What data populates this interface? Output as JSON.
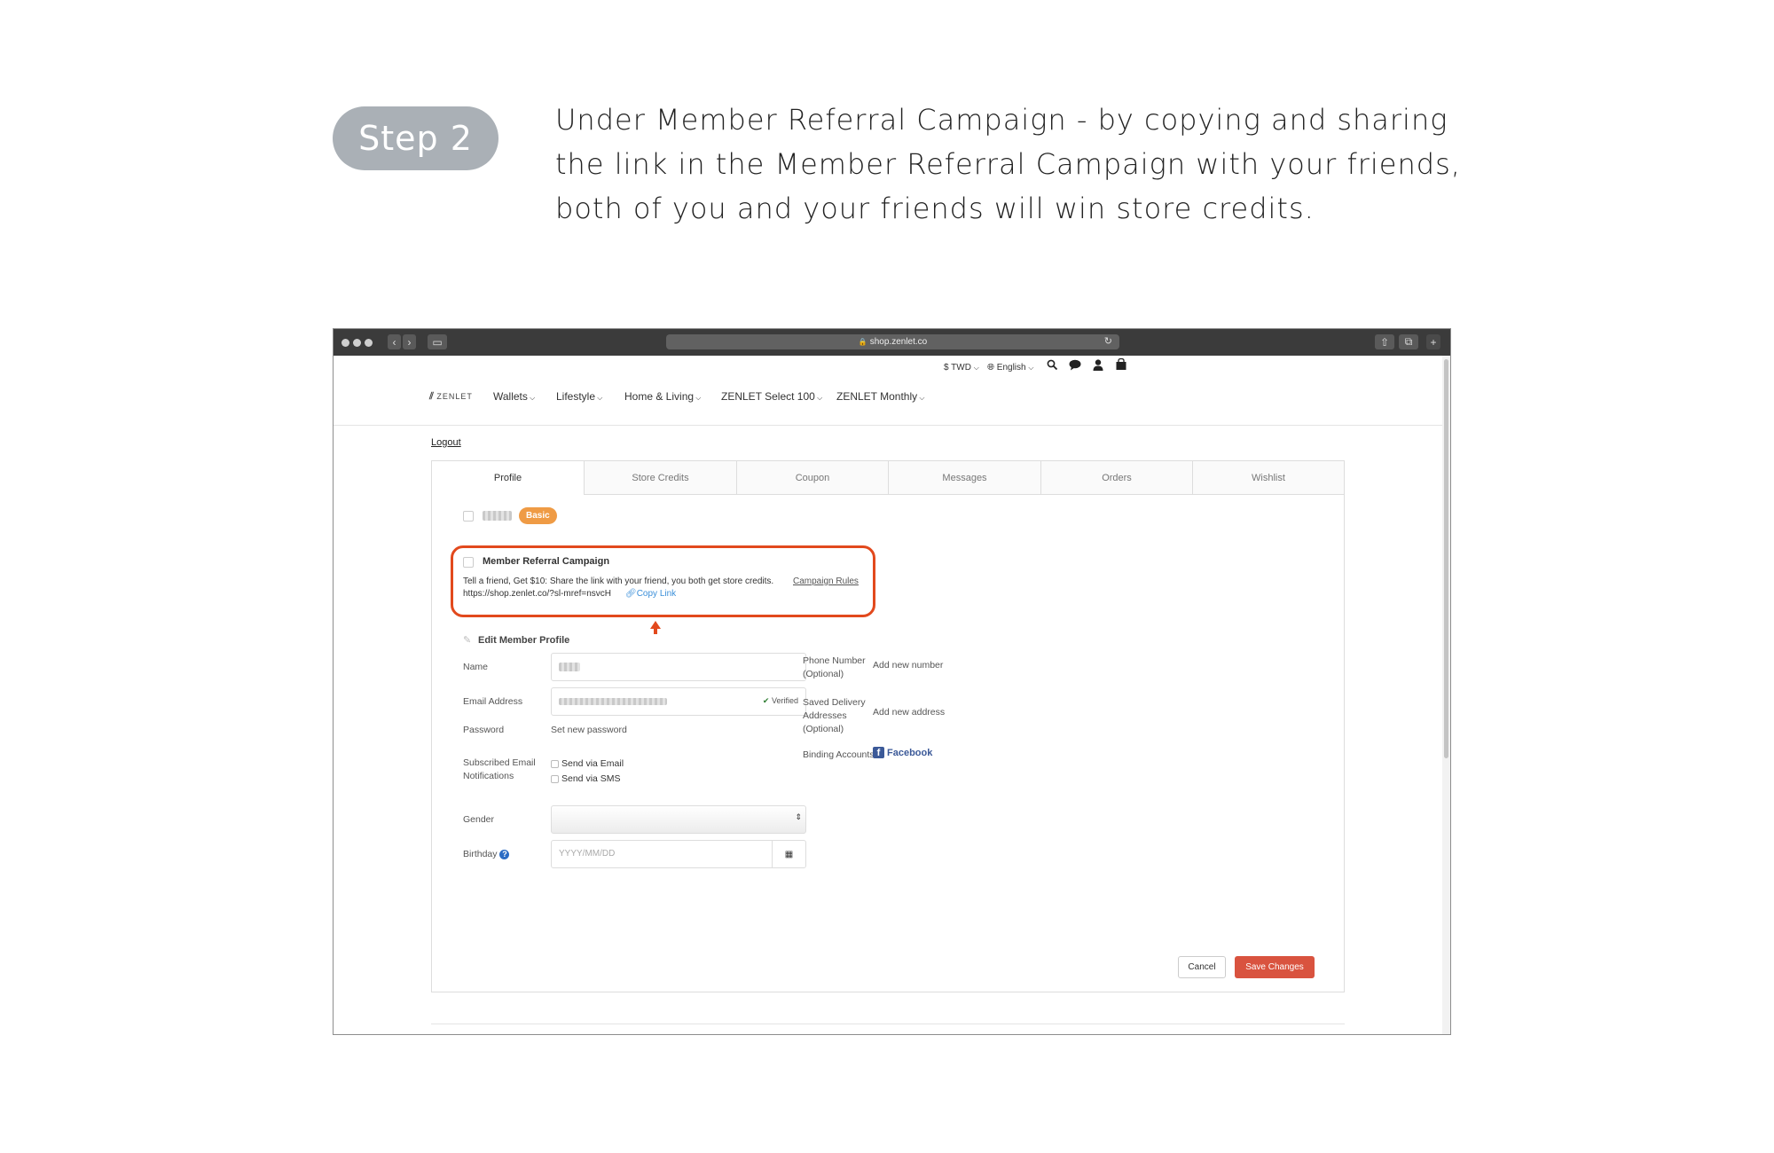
{
  "step": {
    "badge": "Step 2",
    "instruction_lines": [
      "Under Member Referral Campaign - by copying and sharing",
      "the link in the Member Referral Campaign with your friends,",
      "both of you and your friends will win store credits."
    ]
  },
  "browser": {
    "url": "shop.zenlet.co",
    "reload_icon": "↻"
  },
  "utility_bar": {
    "currency": "$ TWD",
    "language": "English",
    "icons": [
      "search-icon",
      "chat-icon",
      "user-icon",
      "cart-icon"
    ]
  },
  "nav": {
    "logo": "ZENLET",
    "menu": [
      "Wallets",
      "Lifestyle",
      "Home & Living",
      "ZENLET Select 100",
      "ZENLET Monthly"
    ]
  },
  "logout": "Logout",
  "tabs": [
    "Profile",
    "Store Credits",
    "Coupon",
    "Messages",
    "Orders",
    "Wishlist"
  ],
  "member": {
    "tier_badge": "Basic"
  },
  "referral": {
    "title": "Member Referral Campaign",
    "description": "Tell a friend, Get $10: Share the link with your friend, you both get store credits.",
    "rules_link": "Campaign Rules",
    "link_url": "https://shop.zenlet.co/?sl-mref=nsvcH",
    "copy_link": "Copy Link"
  },
  "edit_profile": {
    "title": "Edit Member Profile",
    "name_label": "Name",
    "email_label": "Email Address",
    "verified": "Verified",
    "password_label": "Password",
    "password_link": "Set new password",
    "notifications_label": [
      "Subscribed Email",
      "Notifications"
    ],
    "notify_email": "Send via Email",
    "notify_sms": "Send via SMS",
    "gender_label": "Gender",
    "birthday_label": "Birthday",
    "birthday_placeholder": "YYYY/MM/DD",
    "phone_label": [
      "Phone Number",
      "(Optional)"
    ],
    "phone_link": "Add new number",
    "address_label": [
      "Saved Delivery",
      "Addresses",
      "(Optional)"
    ],
    "address_link": "Add new address",
    "binding_label": "Binding Accounts",
    "facebook": "Facebook",
    "cancel": "Cancel",
    "save": "Save Changes"
  },
  "colors": {
    "highlight": "#e2491d",
    "accent_link": "#3b8fd9",
    "save_button": "#d9533f",
    "badge": "#ef9b45",
    "step_badge": "#aab0b6"
  }
}
